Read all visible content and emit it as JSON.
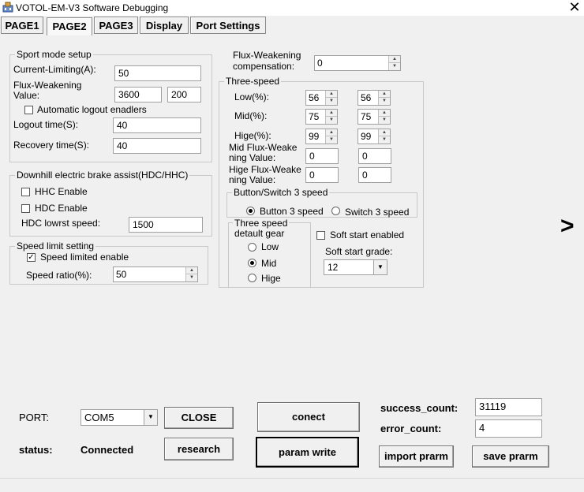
{
  "window": {
    "title": "VOTOL-EM-V3 Software Debugging",
    "close_glyph": "✕"
  },
  "tabs": [
    {
      "label": "PAGE1",
      "active": false
    },
    {
      "label": "PAGE2",
      "active": true
    },
    {
      "label": "PAGE3",
      "active": false
    },
    {
      "label": "Display",
      "active": false
    },
    {
      "label": "Port Settings",
      "active": false
    }
  ],
  "sport": {
    "legend": "Sport mode setup",
    "current_limiting_label": "Current-Limiting(A):",
    "current_limiting_value": "50",
    "flux_label": "Flux-Weakening\nValue:",
    "flux_value_1": "3600",
    "flux_value_2": "200",
    "auto_logout_label": "Automatic logout enadlers",
    "logout_time_label": "Logout time(S):",
    "logout_time_value": "40",
    "recovery_time_label": "Recovery time(S):",
    "recovery_time_value": "40"
  },
  "downhill": {
    "legend": "Downhill electric brake assist(HDC/HHC)",
    "hhc_label": "HHC Enable",
    "hdc_label": "HDC Enable",
    "lowest_speed_label": "HDC lowrst speed:",
    "lowest_speed_value": "1500"
  },
  "speed_limit": {
    "legend": "Speed limit setting",
    "enable_label": "Speed limited enable",
    "enabled": true,
    "ratio_label": "Speed ratio(%):",
    "ratio_value": "50"
  },
  "flux_comp": {
    "label": "Flux-Weakening\ncompensation:",
    "value": "0"
  },
  "three_speed": {
    "legend": "Three-speed",
    "low_label": "Low(%):",
    "low_1": "56",
    "low_2": "56",
    "mid_label": "Mid(%):",
    "mid_1": "75",
    "mid_2": "75",
    "high_label": "Hige(%):",
    "high_1": "99",
    "high_2": "99",
    "mid_flux_label": "Mid Flux-Weake\nning Value:",
    "mid_flux_1": "0",
    "mid_flux_2": "0",
    "high_flux_label": "Hige Flux-Weake\nning Value:",
    "high_flux_1": "0",
    "high_flux_2": "0"
  },
  "button_switch": {
    "legend": "Button/Switch 3 speed",
    "button_label": "Button 3 speed",
    "switch_label": "Switch 3 speed"
  },
  "default_gear": {
    "legend": "Three speed\ndetault gear",
    "low": "Low",
    "mid": "Mid",
    "high": "Hige"
  },
  "soft_start": {
    "enabled_label": "Soft start enabled",
    "grade_label": "Soft start grade:",
    "grade_value": "12"
  },
  "next_arrow": ">",
  "port": {
    "label": "PORT:",
    "value": "COM5",
    "close_button": "CLOSE",
    "status_label": "status:",
    "status_value": "Connected",
    "research_button": "research"
  },
  "actions": {
    "connect_button": "conect",
    "param_write_button": "param write",
    "import_button": "import prarm",
    "save_button": "save prarm"
  },
  "counts": {
    "success_label": "success_count:",
    "success_value": "31119",
    "error_label": "error_count:",
    "error_value": "4"
  }
}
